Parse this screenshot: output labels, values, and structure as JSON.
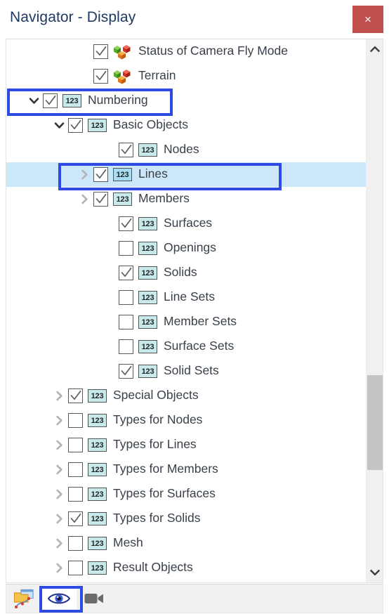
{
  "window": {
    "title": "Navigator - Display",
    "close_label": "×"
  },
  "colors": {
    "title_text": "#1f3864",
    "close_button": "#c0504d",
    "selection": "#cce8f8",
    "annotation": "#2f4ae0",
    "icon_123_fill": "#c9eaea",
    "icon_123_border": "#4f5356",
    "scrollbar_track": "#f0f0f0",
    "scrollbar_thumb": "#c4c4c4",
    "toolbar_bg": "#f1f1f1"
  },
  "tree": {
    "items": [
      {
        "label": "Status of Camera Fly Mode",
        "indent": 2,
        "twisty": "none",
        "checked": true,
        "icon": "cubes-icon",
        "selected": false
      },
      {
        "label": "Terrain",
        "indent": 2,
        "twisty": "none",
        "checked": true,
        "icon": "cubes-icon",
        "selected": false
      },
      {
        "label": "Numbering",
        "indent": 0,
        "twisty": "expanded",
        "checked": true,
        "icon": "123-icon",
        "selected": false
      },
      {
        "label": "Basic Objects",
        "indent": 1,
        "twisty": "expanded",
        "checked": true,
        "icon": "123-icon",
        "selected": false
      },
      {
        "label": "Nodes",
        "indent": 3,
        "twisty": "none",
        "checked": true,
        "icon": "123-icon",
        "selected": false
      },
      {
        "label": "Lines",
        "indent": 2,
        "twisty": "collapsed",
        "checked": true,
        "icon": "123-icon",
        "selected": true
      },
      {
        "label": "Members",
        "indent": 2,
        "twisty": "collapsed",
        "checked": true,
        "icon": "123-icon",
        "selected": false
      },
      {
        "label": "Surfaces",
        "indent": 3,
        "twisty": "none",
        "checked": true,
        "icon": "123-icon",
        "selected": false
      },
      {
        "label": "Openings",
        "indent": 3,
        "twisty": "none",
        "checked": false,
        "icon": "123-icon",
        "selected": false
      },
      {
        "label": "Solids",
        "indent": 3,
        "twisty": "none",
        "checked": true,
        "icon": "123-icon",
        "selected": false
      },
      {
        "label": "Line Sets",
        "indent": 3,
        "twisty": "none",
        "checked": false,
        "icon": "123-icon",
        "selected": false
      },
      {
        "label": "Member Sets",
        "indent": 3,
        "twisty": "none",
        "checked": false,
        "icon": "123-icon",
        "selected": false
      },
      {
        "label": "Surface Sets",
        "indent": 3,
        "twisty": "none",
        "checked": false,
        "icon": "123-icon",
        "selected": false
      },
      {
        "label": "Solid Sets",
        "indent": 3,
        "twisty": "none",
        "checked": true,
        "icon": "123-icon",
        "selected": false
      },
      {
        "label": "Special Objects",
        "indent": 1,
        "twisty": "collapsed",
        "checked": true,
        "icon": "123-icon",
        "selected": false
      },
      {
        "label": "Types for Nodes",
        "indent": 1,
        "twisty": "collapsed",
        "checked": false,
        "icon": "123-icon",
        "selected": false
      },
      {
        "label": "Types for Lines",
        "indent": 1,
        "twisty": "collapsed",
        "checked": false,
        "icon": "123-icon",
        "selected": false
      },
      {
        "label": "Types for Members",
        "indent": 1,
        "twisty": "collapsed",
        "checked": false,
        "icon": "123-icon",
        "selected": false
      },
      {
        "label": "Types for Surfaces",
        "indent": 1,
        "twisty": "collapsed",
        "checked": false,
        "icon": "123-icon",
        "selected": false
      },
      {
        "label": "Types for Solids",
        "indent": 1,
        "twisty": "collapsed",
        "checked": true,
        "icon": "123-icon",
        "selected": false
      },
      {
        "label": "Mesh",
        "indent": 1,
        "twisty": "collapsed",
        "checked": false,
        "icon": "123-icon",
        "selected": false
      },
      {
        "label": "Result Objects",
        "indent": 1,
        "twisty": "collapsed",
        "checked": false,
        "icon": "123-icon",
        "selected": false
      }
    ],
    "icon_123_text": "123"
  },
  "scrollbar": {
    "up_arrow": "∧",
    "down_arrow": "∨"
  },
  "toolbar": {
    "buttons": [
      {
        "name": "open-navigator-icon",
        "active": false
      },
      {
        "name": "eye-visibility-icon",
        "active": true
      },
      {
        "name": "camera-video-icon",
        "active": false
      }
    ]
  }
}
